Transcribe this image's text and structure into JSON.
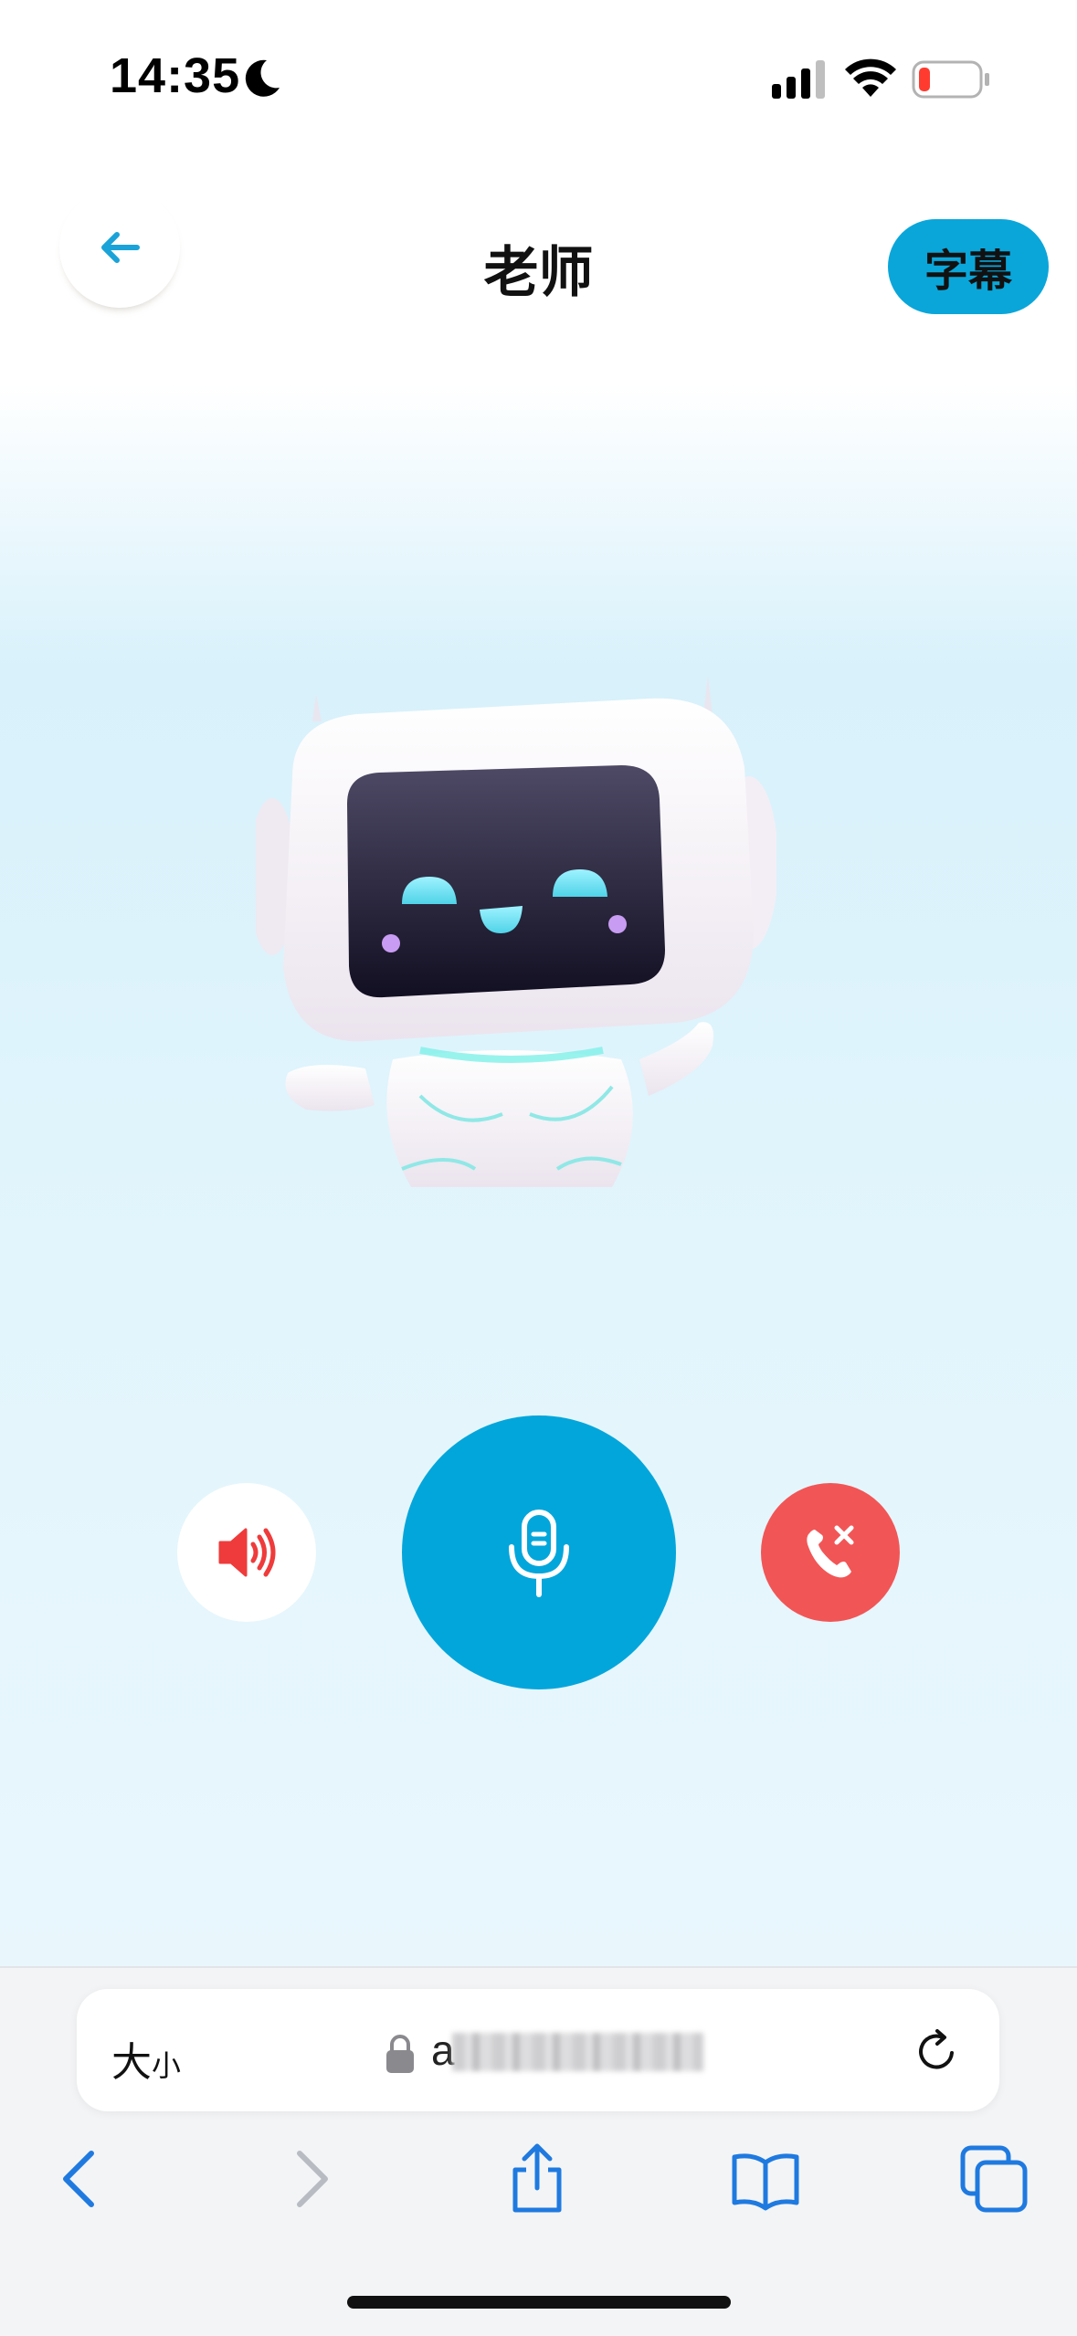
{
  "status_bar": {
    "time": "14:35",
    "moon_icon": "moon-icon",
    "signal_icon": "cellular-signal-icon",
    "wifi_icon": "wifi-icon",
    "battery_icon": "battery-low-icon"
  },
  "header": {
    "back_icon": "arrow-left-icon",
    "title": "老师",
    "subtitle_button": "字幕"
  },
  "main": {
    "avatar": "robot-avatar"
  },
  "controls": {
    "speaker_icon": "speaker-icon",
    "mic_icon": "microphone-icon",
    "hangup_icon": "phone-hangup-icon"
  },
  "browser": {
    "text_size_big": "大",
    "text_size_small": "小",
    "url_visible": "a",
    "toolbar": [
      "back-icon",
      "forward-icon",
      "share-icon",
      "bookmarks-icon",
      "tabs-icon"
    ]
  },
  "colors": {
    "accent": "#03a6db",
    "hangup": "#f25556",
    "speaker_icon": "#ef3b3b",
    "browser_blue": "#1f7ae0"
  }
}
